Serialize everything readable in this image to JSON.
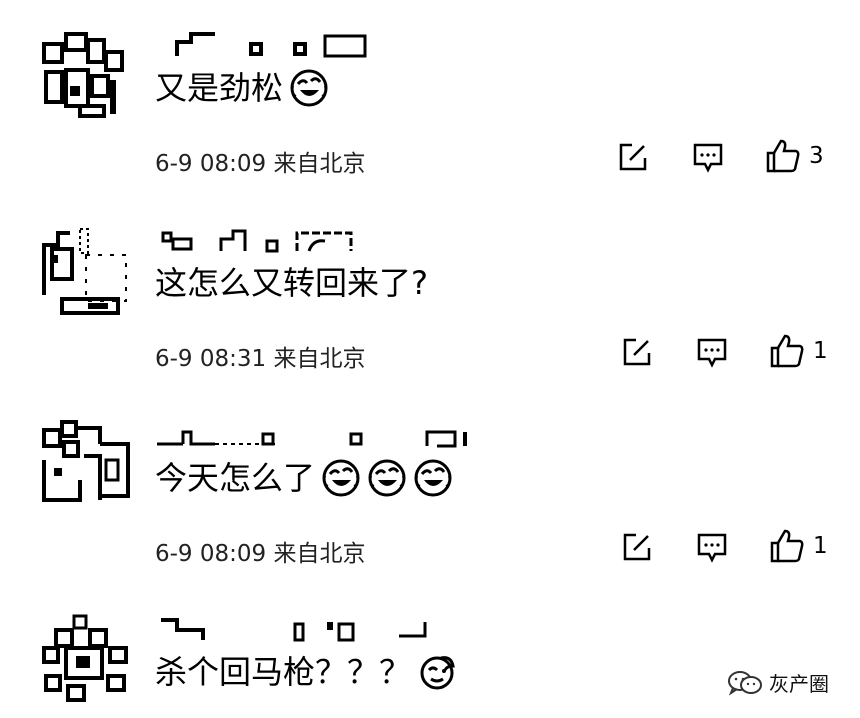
{
  "comments": [
    {
      "text": "又是劲松",
      "emojis": [
        "laugh-cry"
      ],
      "meta": "6-9 08:09 来自北京",
      "likes": "3"
    },
    {
      "text": "这怎么又转回来了?",
      "emojis": [],
      "meta": "6-9 08:31 来自北京",
      "likes": "1"
    },
    {
      "text": "今天怎么了",
      "emojis": [
        "laugh-cry",
        "laugh-cry",
        "laugh-cry"
      ],
      "meta": "6-9 08:09 来自北京",
      "likes": "1"
    },
    {
      "text": "杀个回马枪？？？",
      "emojis": [
        "slap-face"
      ],
      "meta": "",
      "likes": ""
    }
  ],
  "icons": {
    "reply": "edit-icon",
    "comment": "comment-icon",
    "like": "thumbs-up-icon"
  },
  "watermark": {
    "label": "灰产圈",
    "icon": "wechat-icon"
  }
}
